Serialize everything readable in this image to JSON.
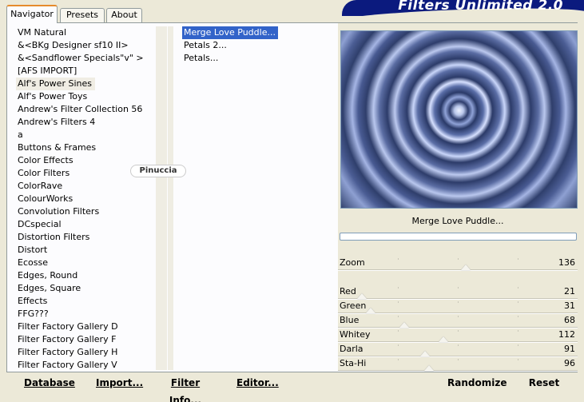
{
  "banner": {
    "title": "Filters Unlimited 2.0"
  },
  "tabs": [
    {
      "label": "Navigator",
      "active": true
    },
    {
      "label": "Presets",
      "active": false
    },
    {
      "label": "About",
      "active": false
    }
  ],
  "categories": [
    "VM Natural",
    "&<BKg Designer sf10 II>",
    "&<Sandflower Specials\"v\" >",
    "[AFS IMPORT]",
    "Alf's Power Sines",
    "Alf's Power Toys",
    "Andrew's Filter Collection 56",
    "Andrew's Filters 4",
    "a",
    "Buttons & Frames",
    "Color Effects",
    "Color Filters",
    "ColorRave",
    "ColourWorks",
    "Convolution Filters",
    "DCspecial",
    "Distortion Filters",
    "Distort",
    "Ecosse",
    "Edges, Round",
    "Edges, Square",
    "Effects",
    "FFG???",
    "Filter Factory Gallery D",
    "Filter Factory Gallery F",
    "Filter Factory Gallery H",
    "Filter Factory Gallery V"
  ],
  "selected_category_index": 4,
  "filters": [
    "Merge Love Puddle...",
    "Petals 2...",
    "Petals..."
  ],
  "selected_filter_index": 0,
  "watermark": "Pinuccia",
  "preview": {
    "filter_name": "Merge Love Puddle..."
  },
  "sliders": [
    {
      "label": "Zoom",
      "value": "136",
      "max": 255
    },
    {
      "label": "Red",
      "value": "21",
      "max": 255
    },
    {
      "label": "Green",
      "value": "31",
      "max": 255
    },
    {
      "label": "Blue",
      "value": "68",
      "max": 255
    },
    {
      "label": "Whitey",
      "value": "112",
      "max": 255
    },
    {
      "label": "Darla",
      "value": "91",
      "max": 255
    },
    {
      "label": "Sta-Hi",
      "value": "96",
      "max": 255
    }
  ],
  "buttons": {
    "database": "Database",
    "import": "Import...",
    "filter_info": "Filter Info...",
    "editor": "Editor...",
    "randomize": "Randomize",
    "reset": "Reset"
  }
}
